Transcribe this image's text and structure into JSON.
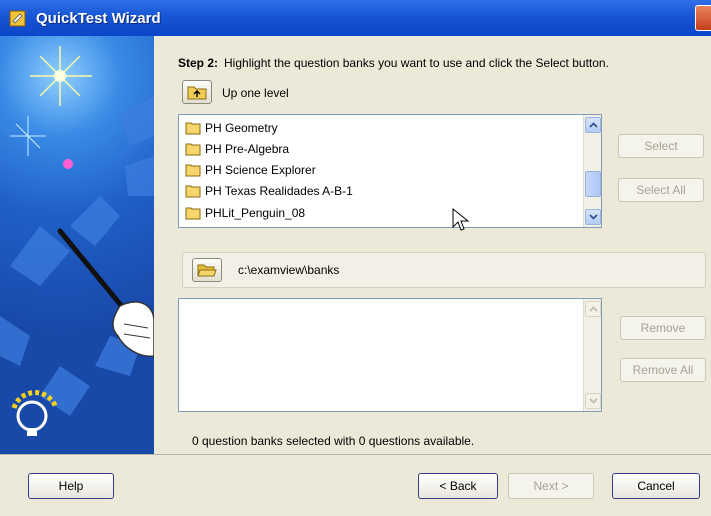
{
  "window": {
    "title": "QuickTest Wizard"
  },
  "step": {
    "label": "Step 2:",
    "instruction": "Highlight the question banks you want to use and click the Select button."
  },
  "navigation": {
    "up_label": "Up one level",
    "current_path": "c:\\examview\\banks"
  },
  "banks_list": {
    "items": [
      {
        "label": "PH Geometry"
      },
      {
        "label": "PH Pre-Algebra"
      },
      {
        "label": "PH Science Explorer"
      },
      {
        "label": "PH Texas Realidades A-B-1"
      },
      {
        "label": "PHLit_Penguin_08"
      }
    ]
  },
  "buttons": {
    "select": "Select",
    "select_all": "Select All",
    "remove": "Remove",
    "remove_all": "Remove All",
    "help": "Help",
    "back": "< Back",
    "next": "Next >",
    "cancel": "Cancel"
  },
  "status": {
    "text": "0 question banks selected with 0 questions available."
  },
  "icons": {
    "app": "wizard-icon",
    "up_level": "folder-up-icon",
    "path": "folder-open-icon",
    "list_item": "folder-icon",
    "close": "close-icon"
  }
}
